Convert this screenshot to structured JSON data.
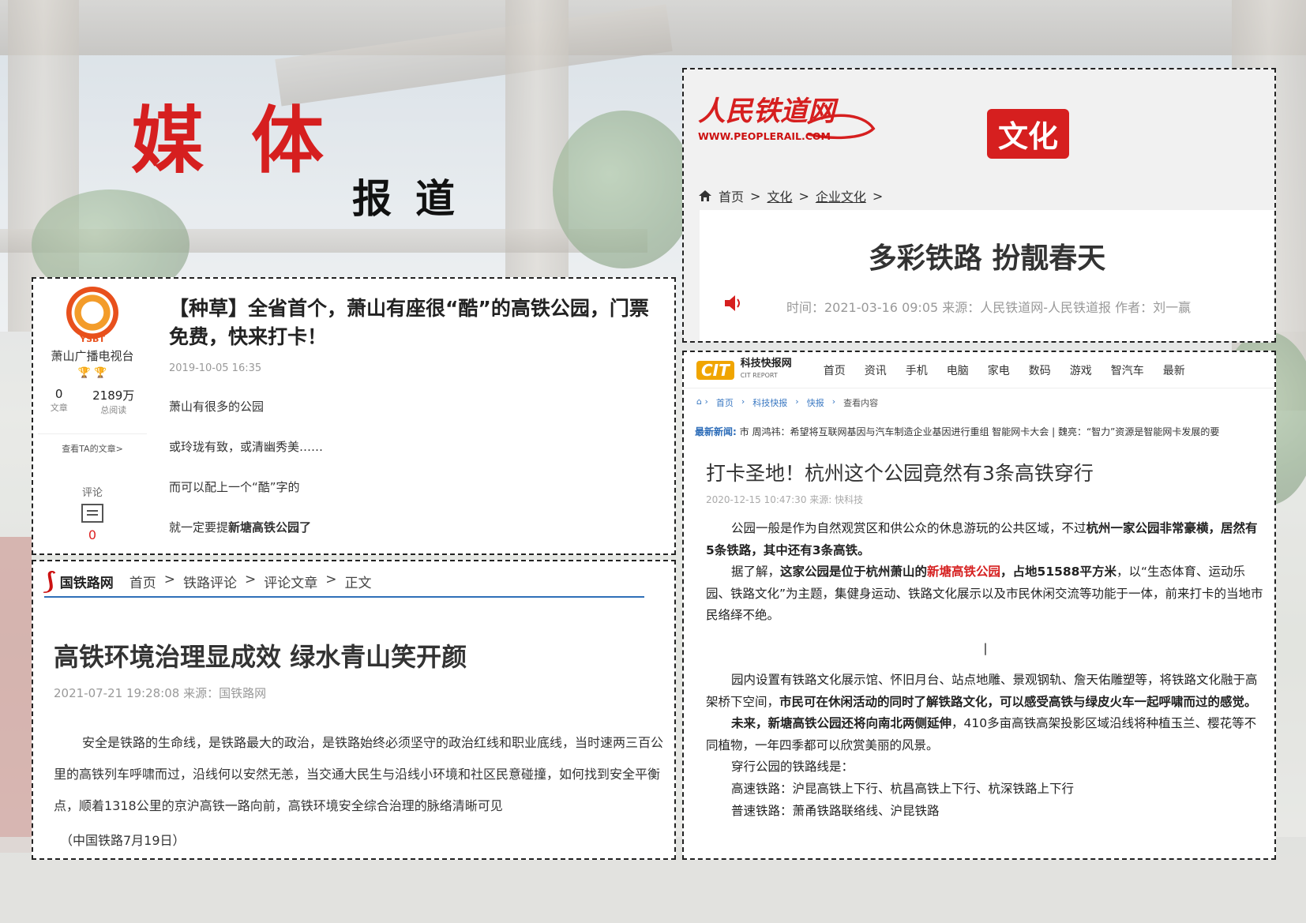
{
  "heading": {
    "big": "媒体",
    "small": "报道"
  },
  "panel_xiaoshan": {
    "logo_text": "YSBT",
    "account_name": "萧山广播电视台",
    "medals": "🏆 🏆",
    "stats": [
      {
        "value": "0",
        "label": "文章"
      },
      {
        "value": "2189万",
        "label": "总阅读"
      }
    ],
    "view_link": "查看TA的文章>",
    "comment_label": "评论",
    "comment_count": "0",
    "title": "【种草】全省首个，萧山有座很“酷”的高铁公园，门票免费，快来打卡！",
    "date": "2019-10-05 16:35",
    "paragraphs": [
      "萧山有很多的公园",
      "或玲珑有致，或清幽秀美……",
      "而可以配上一个“酷”字的",
      "就一定要提"
    ],
    "paragraph_bold": "新塘高铁公园了"
  },
  "panel_peoplerail": {
    "logo_cn": "人民铁道网",
    "logo_url": "WWW.PEOPLERAIL.COM",
    "section_badge": "文化",
    "breadcrumb": [
      "首页",
      ">",
      "文化",
      ">",
      "企业文化",
      ">"
    ],
    "title": "多彩铁路 扮靓春天",
    "meta": "时间：2021-03-16 09:05    来源：人民铁道网-人民铁道报    作者：刘一赢"
  },
  "panel_guotielu": {
    "logo_text": "国铁路网",
    "breadcrumb": [
      "首页",
      ">",
      "铁路评论",
      ">",
      "评论文章",
      ">",
      "正文"
    ],
    "title": "高铁环境治理显成效 绿水青山笑开颜",
    "meta": "2021-07-21 19:28:08    来源：国铁路网",
    "body": "安全是铁路的生命线，是铁路最大的政治，是铁路始终必须坚守的政治红线和职业底线，当时速两三百公里的高铁列车呼啸而过，沿线何以安然无恙，当交通大民生与沿线小环境和社区民意碰撞，如何找到安全平衡点，顺着1318公里的京沪高铁一路向前，高铁环境安全综合治理的脉络清晰可见",
    "source": "（中国铁路7月19日）"
  },
  "panel_cit": {
    "logo_cit": "CIT",
    "logo_name": "科技快报网",
    "logo_en": "CIT REPORT",
    "nav": [
      "首页",
      "资讯",
      "手机",
      "电脑",
      "家电",
      "数码",
      "游戏",
      "智汽车",
      "最新"
    ],
    "breadcrumb": [
      "首页",
      "科技快报",
      "快报",
      "查看内容"
    ],
    "news_label": "最新新闻:",
    "news_ticker": "市    周鸿祎：希望将互联网基因与汽车制造企业基因进行重组    智能网卡大会 | 魏亮：“智力”资源是智能网卡发展的要",
    "title": "打卡圣地！杭州这个公园竟然有3条高铁穿行",
    "meta": "2020-12-15 10:47:30  来源: 快科技",
    "p1_a": "公园一般是作为自然观赏区和供公众的休息游玩的公共区域，不过",
    "p1_b": "杭州一家公园非常豪横，居然有5条铁路，其中还有3条高铁。",
    "p2_a": "据了解，",
    "p2_b": "这家公园是位于杭州萧山的",
    "p2_red": "新塘高铁公园",
    "p2_c": "，占地51588平方米",
    "p2_d": "，以“生态体育、运动乐园、铁路文化”为主题，集健身运动、铁路文化展示以及市民休闲交流等功能于一体，前来打卡的当地市民络绎不绝。",
    "cursor": "|",
    "p3_a": "园内设置有铁路文化展示馆、怀旧月台、站点地雕、景观钢轨、詹天佑雕塑等，将铁路文化融于高架桥下空间，",
    "p3_b": "市民可在休闲活动的同时了解铁路文化，可以感受高铁与绿皮火车一起呼啸而过的感觉。",
    "p4_a": "未来，新塘高铁公园还将向南北两侧延伸",
    "p4_b": "，410多亩高铁高架投影区域沿线将种植玉兰、樱花等不同植物，一年四季都可以欣赏美丽的风景。",
    "p5": "穿行公园的铁路线是：",
    "p6": "高速铁路：沪昆高铁上下行、杭昌高铁上下行、杭深铁路上下行",
    "p7": "普速铁路：萧甬铁路联络线、沪昆铁路"
  }
}
